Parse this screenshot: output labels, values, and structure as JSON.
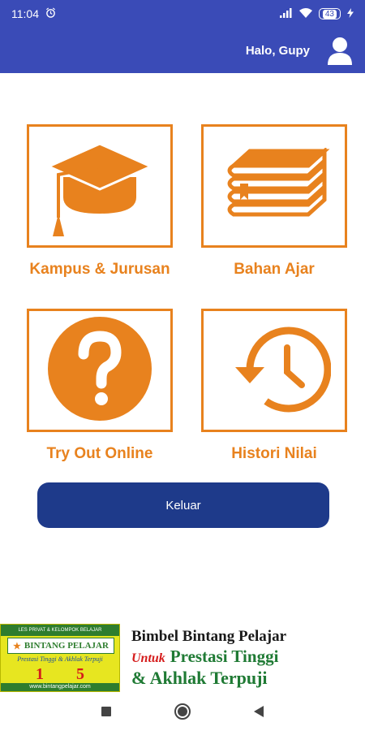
{
  "status_bar": {
    "time": "11:04",
    "battery": "43"
  },
  "header": {
    "greeting": "Halo, Gupy"
  },
  "menu": [
    {
      "label": "Kampus & Jurusan",
      "icon": "graduation-cap-icon"
    },
    {
      "label": "Bahan Ajar",
      "icon": "books-icon"
    },
    {
      "label": "Try Out Online",
      "icon": "question-icon"
    },
    {
      "label": "Histori Nilai",
      "icon": "history-icon"
    }
  ],
  "logout": {
    "label": "Keluar"
  },
  "banner": {
    "logo_top": "LES PRIVAT & KELOMPOK BELAJAR",
    "logo_brand": "BINTANG PELAJAR",
    "logo_tagline": "Prestasi Tinggi & Akhlak Terpuji",
    "logo_grade_from": "1",
    "logo_grade_to": "5",
    "logo_url": "www.bintangpelajar.com",
    "line1": "Bimbel Bintang Pelajar",
    "line2_prefix": "Untuk",
    "line2_main": "Prestasi Tinggi",
    "line3": "& Akhlak Terpuji"
  },
  "colors": {
    "primary": "#3a4bb7",
    "accent": "#e8821e",
    "button": "#1e3a8a"
  }
}
